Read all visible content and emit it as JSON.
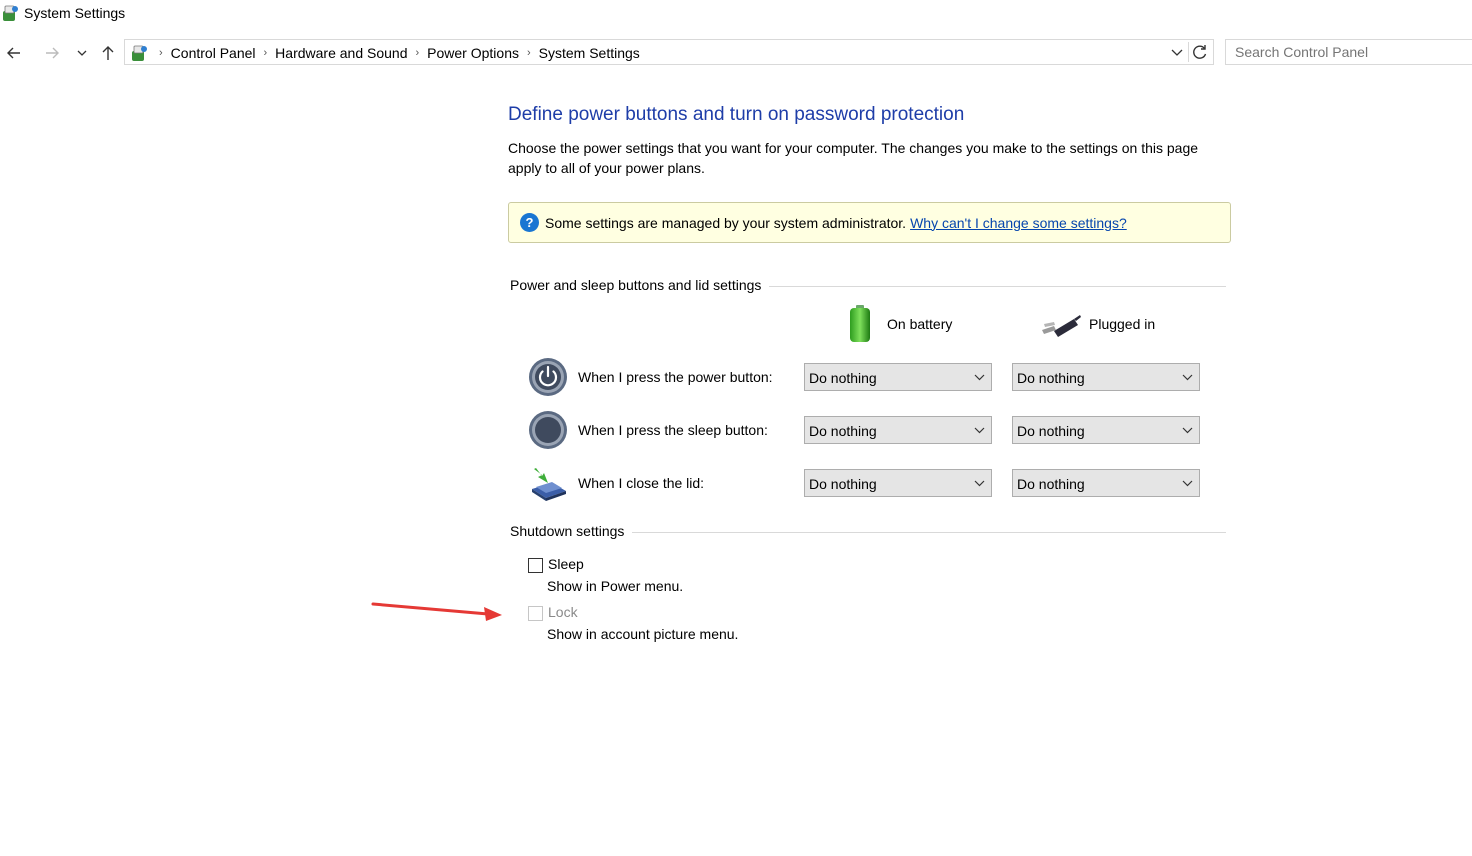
{
  "window": {
    "title": "System Settings"
  },
  "address_bar": {
    "breadcrumbs": [
      "Control Panel",
      "Hardware and Sound",
      "Power Options",
      "System Settings"
    ]
  },
  "search": {
    "placeholder": "Search Control Panel"
  },
  "page": {
    "heading": "Define power buttons and turn on password protection",
    "description": "Choose the power settings that you want for your computer. The changes you make to the settings on this page apply to all of your power plans."
  },
  "admin_banner": {
    "text": "Some settings are managed by your system administrator.",
    "link": "Why can't I change some settings?"
  },
  "buttons_group": {
    "label": "Power and sleep buttons and lid settings",
    "columns": {
      "battery": "On battery",
      "plugged": "Plugged in"
    },
    "rows": [
      {
        "label": "When I press the power button:",
        "battery": "Do nothing",
        "plugged": "Do nothing",
        "icon": "power-button-icon"
      },
      {
        "label": "When I press the sleep button:",
        "battery": "Do nothing",
        "plugged": "Do nothing",
        "icon": "sleep-button-icon"
      },
      {
        "label": "When I close the lid:",
        "battery": "Do nothing",
        "plugged": "Do nothing",
        "icon": "laptop-lid-icon"
      }
    ]
  },
  "shutdown_group": {
    "label": "Shutdown settings",
    "items": [
      {
        "label": "Sleep",
        "sub": "Show in Power menu.",
        "checked": false,
        "enabled": true
      },
      {
        "label": "Lock",
        "sub": "Show in account picture menu.",
        "checked": false,
        "enabled": false
      }
    ]
  },
  "colors": {
    "heading": "#1e3da8",
    "link": "#0645ad",
    "banner_bg": "#ffffe1",
    "annotation_arrow": "#e53935"
  }
}
